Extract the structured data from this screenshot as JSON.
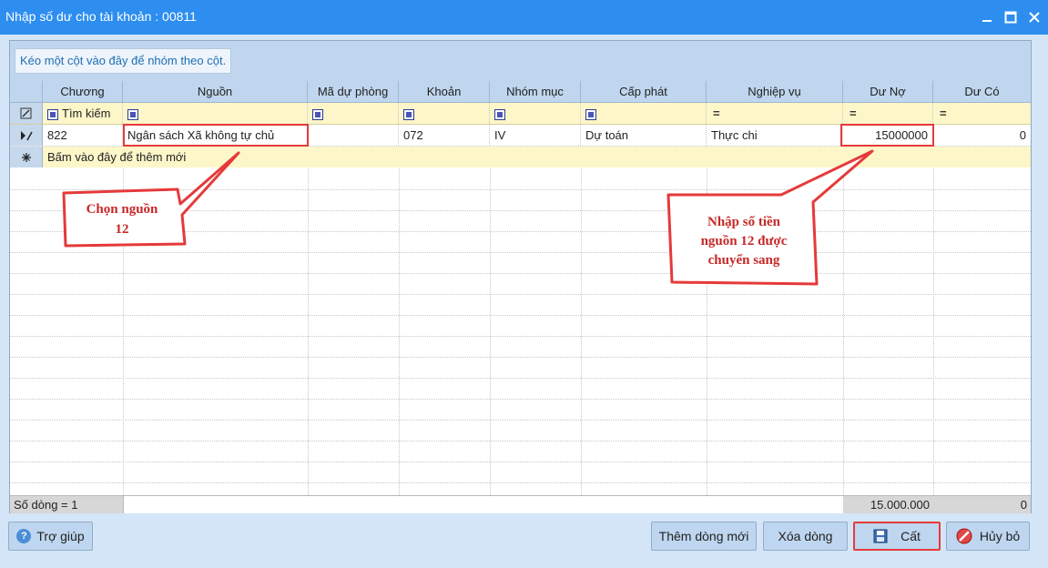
{
  "window": {
    "title": "Nhập số dư cho tài khoản : 00811"
  },
  "grid": {
    "group_hint": "Kéo một cột vào đây để nhóm theo cột.",
    "columns": [
      "Chương",
      "Nguồn",
      "Mã dự phòng",
      "Khoản",
      "Nhóm mục",
      "Cấp phát",
      "Nghiệp vụ",
      "Dư Nợ",
      "Dư Có"
    ],
    "filter": {
      "search_label": "Tìm kiếm",
      "eq_symbol": "="
    },
    "row": {
      "chuong": "822",
      "nguon": "Ngân sách Xã không tự chủ",
      "ma_du_phong": "",
      "khoan": "072",
      "nhom_muc": "IV",
      "cap_phat": "Dự toán",
      "nghiep_vu": "Thực chi",
      "du_no": "15000000",
      "du_co": "0"
    },
    "new_row_hint": "Bấm vào đây để thêm mới",
    "footer": {
      "row_count": "Số dòng = 1",
      "total_du_no": "15.000.000",
      "total_du_co": "0"
    }
  },
  "callouts": {
    "left": [
      "Chọn nguồn",
      "12"
    ],
    "right": [
      "Nhập số tiền",
      "nguồn 12 được",
      "chuyển sang"
    ]
  },
  "buttons": {
    "help": "Trợ giúp",
    "add_row": "Thêm dòng mới",
    "delete_row": "Xóa dòng",
    "save": "Cất",
    "cancel": "Hủy bỏ"
  },
  "colors": {
    "titlebar": "#2d8ef0",
    "highlight": "#e53a3a",
    "filter_row": "#fdf6c9"
  }
}
